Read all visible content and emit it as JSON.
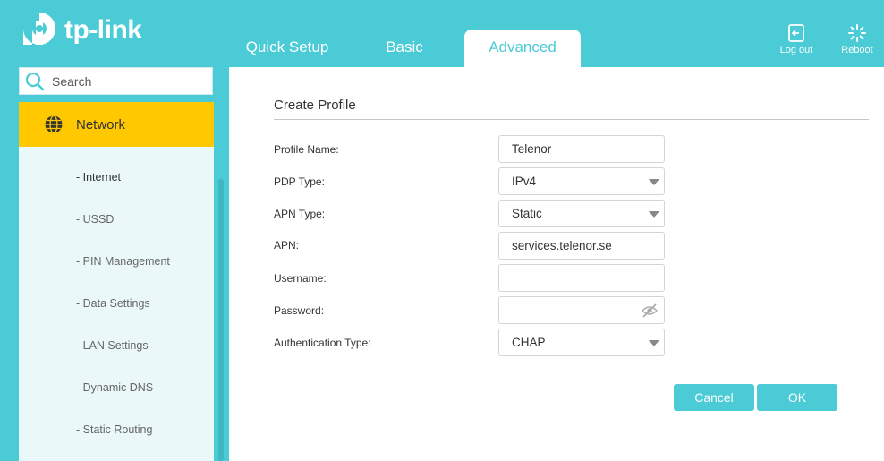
{
  "header": {
    "logo_text": "tp-link",
    "tabs": [
      {
        "label": "Quick Setup"
      },
      {
        "label": "Basic"
      },
      {
        "label": "Advanced"
      }
    ],
    "logout_label": "Log out",
    "reboot_label": "Reboot"
  },
  "sidebar": {
    "search_placeholder": "Search",
    "section_label": "Network",
    "items": [
      {
        "label": "- Internet"
      },
      {
        "label": "- USSD"
      },
      {
        "label": "- PIN Management"
      },
      {
        "label": "- Data Settings"
      },
      {
        "label": "- LAN Settings"
      },
      {
        "label": "- Dynamic DNS"
      },
      {
        "label": "- Static Routing"
      }
    ]
  },
  "form": {
    "title": "Create Profile",
    "fields": {
      "profile_name": {
        "label": "Profile Name:",
        "value": "Telenor"
      },
      "pdp_type": {
        "label": "PDP Type:",
        "value": "IPv4"
      },
      "apn_type": {
        "label": "APN Type:",
        "value": "Static"
      },
      "apn": {
        "label": "APN:",
        "value": "services.telenor.se"
      },
      "username": {
        "label": "Username:",
        "value": ""
      },
      "password": {
        "label": "Password:",
        "value": ""
      },
      "auth_type": {
        "label": "Authentication Type:",
        "value": "CHAP"
      }
    },
    "cancel_label": "Cancel",
    "ok_label": "OK"
  },
  "colors": {
    "brand": "#4acbd6",
    "nav_highlight": "#ffc800",
    "sidebar_bg": "#eaf8f9"
  }
}
